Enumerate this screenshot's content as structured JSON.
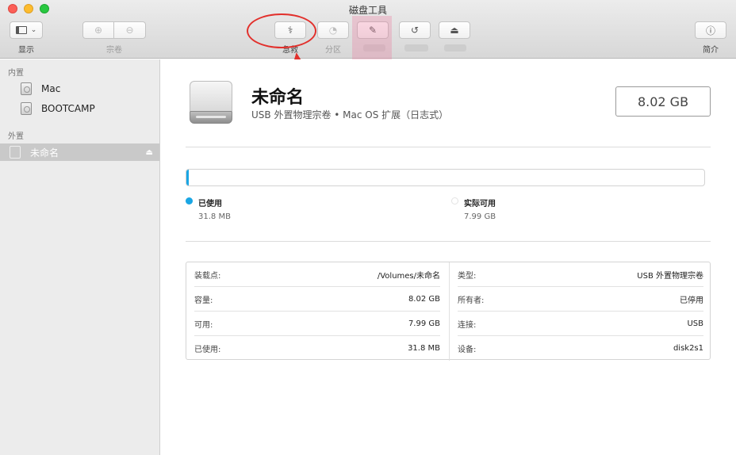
{
  "window": {
    "title": "磁盘工具"
  },
  "toolbar": {
    "view_label": "显示",
    "volume_label": "宗卷",
    "first_aid_label": "急救",
    "partition_label": "分区",
    "info_label": "简介"
  },
  "sidebar": {
    "internal_header": "内置",
    "internal_items": [
      "Mac",
      "BOOTCAMP"
    ],
    "external_header": "外置",
    "external_items": [
      "未命名"
    ]
  },
  "volume": {
    "name": "未命名",
    "description": "USB 外置物理宗卷 • Mac OS 扩展（日志式）",
    "size": "8.02 GB",
    "used_fraction": 0.004,
    "used_label": "已使用",
    "used_value": "31.8 MB",
    "free_label": "实际可用",
    "free_value": "7.99 GB",
    "used_color": "#1aa6e4"
  },
  "info": {
    "left": [
      {
        "key": "装载点:",
        "value": "/Volumes/未命名"
      },
      {
        "key": "容量:",
        "value": "8.02 GB"
      },
      {
        "key": "可用:",
        "value": "7.99 GB"
      },
      {
        "key": "已使用:",
        "value": "31.8 MB"
      }
    ],
    "right": [
      {
        "key": "类型:",
        "value": "USB 外置物理宗卷"
      },
      {
        "key": "所有者:",
        "value": "已停用"
      },
      {
        "key": "连接:",
        "value": "USB"
      },
      {
        "key": "设备:",
        "value": "disk2s1"
      }
    ]
  },
  "annotation": {
    "color": "#e2302c"
  }
}
